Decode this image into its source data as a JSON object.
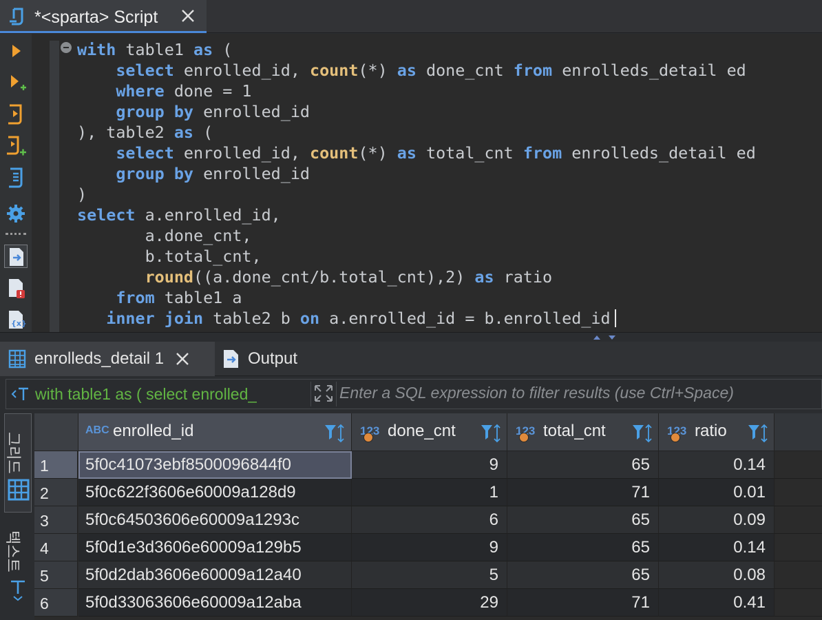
{
  "editor_tab": {
    "title": "*<sparta> Script"
  },
  "code_lines": [
    [
      {
        "k": "kw",
        "t": "with"
      },
      {
        "k": "",
        "t": " table1 "
      },
      {
        "k": "kw",
        "t": "as"
      },
      {
        "k": "",
        "t": " ("
      }
    ],
    [
      {
        "k": "",
        "t": "    "
      },
      {
        "k": "kw",
        "t": "select"
      },
      {
        "k": "",
        "t": " enrolled_id, "
      },
      {
        "k": "fn",
        "t": "count"
      },
      {
        "k": "",
        "t": "(*) "
      },
      {
        "k": "kw",
        "t": "as"
      },
      {
        "k": "",
        "t": " done_cnt "
      },
      {
        "k": "kw",
        "t": "from"
      },
      {
        "k": "",
        "t": " enrolleds_detail ed"
      }
    ],
    [
      {
        "k": "",
        "t": "    "
      },
      {
        "k": "kw",
        "t": "where"
      },
      {
        "k": "",
        "t": " done = 1"
      }
    ],
    [
      {
        "k": "",
        "t": "    "
      },
      {
        "k": "kw",
        "t": "group by"
      },
      {
        "k": "",
        "t": " enrolled_id"
      }
    ],
    [
      {
        "k": "",
        "t": "), table2 "
      },
      {
        "k": "kw",
        "t": "as"
      },
      {
        "k": "",
        "t": " ("
      }
    ],
    [
      {
        "k": "",
        "t": "    "
      },
      {
        "k": "kw",
        "t": "select"
      },
      {
        "k": "",
        "t": " enrolled_id, "
      },
      {
        "k": "fn",
        "t": "count"
      },
      {
        "k": "",
        "t": "(*) "
      },
      {
        "k": "kw",
        "t": "as"
      },
      {
        "k": "",
        "t": " total_cnt "
      },
      {
        "k": "kw",
        "t": "from"
      },
      {
        "k": "",
        "t": " enrolleds_detail ed"
      }
    ],
    [
      {
        "k": "",
        "t": "    "
      },
      {
        "k": "kw",
        "t": "group by"
      },
      {
        "k": "",
        "t": " enrolled_id"
      }
    ],
    [
      {
        "k": "",
        "t": ")"
      }
    ],
    [
      {
        "k": "kw",
        "t": "select"
      },
      {
        "k": "",
        "t": " a.enrolled_id,"
      }
    ],
    [
      {
        "k": "",
        "t": "       a.done_cnt,"
      }
    ],
    [
      {
        "k": "",
        "t": "       b.total_cnt,"
      }
    ],
    [
      {
        "k": "",
        "t": "       "
      },
      {
        "k": "fn",
        "t": "round"
      },
      {
        "k": "",
        "t": "((a.done_cnt/b.total_cnt),2) "
      },
      {
        "k": "kw",
        "t": "as"
      },
      {
        "k": "",
        "t": " ratio"
      }
    ],
    [
      {
        "k": "",
        "t": "    "
      },
      {
        "k": "kw",
        "t": "from"
      },
      {
        "k": "",
        "t": " table1 a"
      }
    ],
    [
      {
        "k": "",
        "t": "   "
      },
      {
        "k": "kw",
        "t": "inner join"
      },
      {
        "k": "",
        "t": " table2 b "
      },
      {
        "k": "kw",
        "t": "on"
      },
      {
        "k": "",
        "t": " a.enrolled_id = b.enrolled_id"
      }
    ]
  ],
  "results_tabs": [
    {
      "label": "enrolleds_detail 1",
      "icon": "grid-icon",
      "active": true
    },
    {
      "label": "Output",
      "icon": "output-icon",
      "active": false
    }
  ],
  "filter": {
    "query_preview": "with table1 as ( select enrolled_",
    "placeholder": "Enter a SQL expression to filter results (use Ctrl+Space)"
  },
  "side_tabs": {
    "grid": "그리드",
    "text": "텍스트"
  },
  "columns": [
    {
      "name": "enrolled_id",
      "type": "ABC"
    },
    {
      "name": "done_cnt",
      "type": "123"
    },
    {
      "name": "total_cnt",
      "type": "123"
    },
    {
      "name": "ratio",
      "type": "123"
    }
  ],
  "rows": [
    {
      "n": "1",
      "enrolled_id": "5f0c41073ebf8500096844f0",
      "done_cnt": "9",
      "total_cnt": "65",
      "ratio": "0.14"
    },
    {
      "n": "2",
      "enrolled_id": "5f0c622f3606e60009a128d9",
      "done_cnt": "1",
      "total_cnt": "71",
      "ratio": "0.01"
    },
    {
      "n": "3",
      "enrolled_id": "5f0c64503606e60009a1293c",
      "done_cnt": "6",
      "total_cnt": "65",
      "ratio": "0.09"
    },
    {
      "n": "4",
      "enrolled_id": "5f0d1e3d3606e60009a129b5",
      "done_cnt": "9",
      "total_cnt": "65",
      "ratio": "0.14"
    },
    {
      "n": "5",
      "enrolled_id": "5f0d2dab3606e60009a12a40",
      "done_cnt": "5",
      "total_cnt": "65",
      "ratio": "0.08"
    },
    {
      "n": "6",
      "enrolled_id": "5f0d33063606e60009a12aba",
      "done_cnt": "29",
      "total_cnt": "71",
      "ratio": "0.41"
    }
  ],
  "colors": {
    "accent": "#4a88d8",
    "keyword": "#6aa3e6",
    "function": "#e5c07b",
    "tool_orange": "#f0a030",
    "filter_text": "#62b543"
  }
}
